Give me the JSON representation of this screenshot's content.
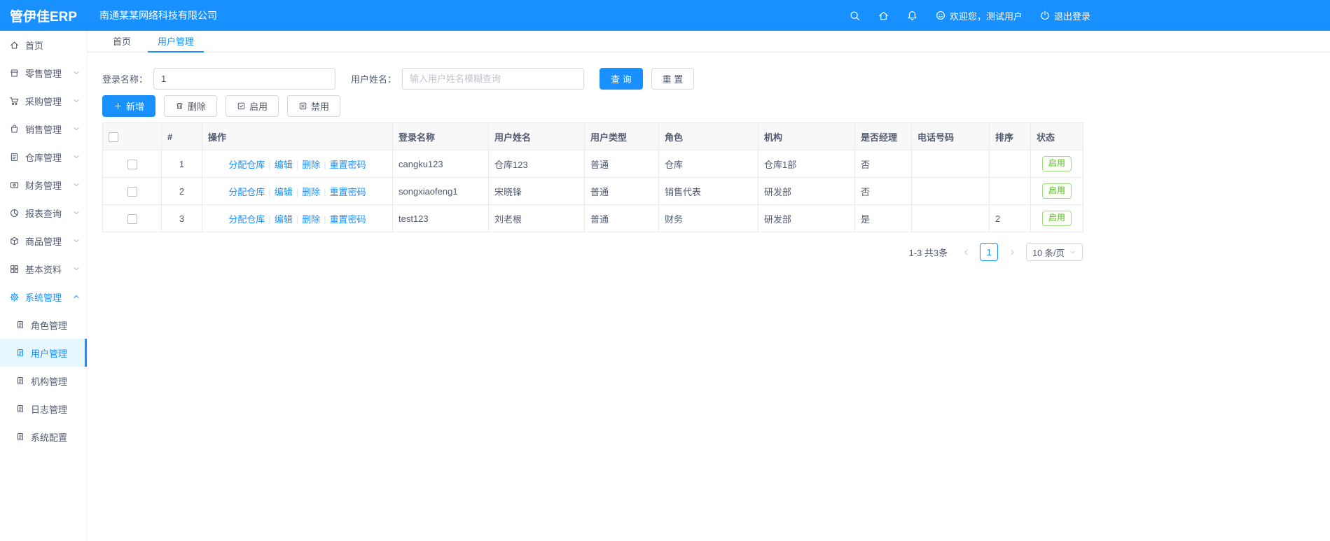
{
  "colors": {
    "primary": "#1890ff",
    "success": "#52c41a",
    "header_blue": "#1890ff"
  },
  "header": {
    "logo": "管伊佳ERP",
    "company": "南通某某网络科技有限公司",
    "welcome": "欢迎您，测试用户",
    "logout": "退出登录"
  },
  "tabs": [
    "首页",
    "用户管理"
  ],
  "sidebar": {
    "items": [
      "首页",
      "零售管理",
      "采购管理",
      "销售管理",
      "仓库管理",
      "财务管理",
      "报表查询",
      "商品管理",
      "基本资料",
      "系统管理"
    ],
    "system_children": [
      "角色管理",
      "用户管理",
      "机构管理",
      "日志管理",
      "系统配置"
    ]
  },
  "filters": {
    "login_label": "登录名称：",
    "login_value": "1",
    "name_label": "用户姓名：",
    "name_placeholder": "输入用户姓名模糊查询",
    "search_button": "查 询",
    "reset_button": "重 置"
  },
  "toolbar": {
    "add": "新增",
    "delete": "删除",
    "enable": "启用",
    "disable": "禁用"
  },
  "table": {
    "headers": [
      "#",
      "操作",
      "登录名称",
      "用户姓名",
      "用户类型",
      "角色",
      "机构",
      "是否经理",
      "电话号码",
      "排序",
      "状态"
    ],
    "op_links": [
      "分配仓库",
      "编辑",
      "删除",
      "重置密码"
    ],
    "op_sep": "|",
    "rows": [
      {
        "index": "1",
        "login": "cangku123",
        "name": "仓库123",
        "type": "普通",
        "role": "仓库",
        "org": "仓库1部",
        "manager": "否",
        "phone": "",
        "sort": "",
        "status": "启用"
      },
      {
        "index": "2",
        "login": "songxiaofeng1",
        "name": "宋晓锋",
        "type": "普通",
        "role": "销售代表",
        "org": "研发部",
        "manager": "否",
        "phone": "",
        "sort": "",
        "status": "启用"
      },
      {
        "index": "3",
        "login": "test123",
        "name": "刘老根",
        "type": "普通",
        "role": "财务",
        "org": "研发部",
        "manager": "是",
        "phone": "",
        "sort": "2",
        "status": "启用"
      }
    ]
  },
  "pagination": {
    "total": "1-3 共3条",
    "current_page": "1",
    "page_size": "10 条/页"
  }
}
